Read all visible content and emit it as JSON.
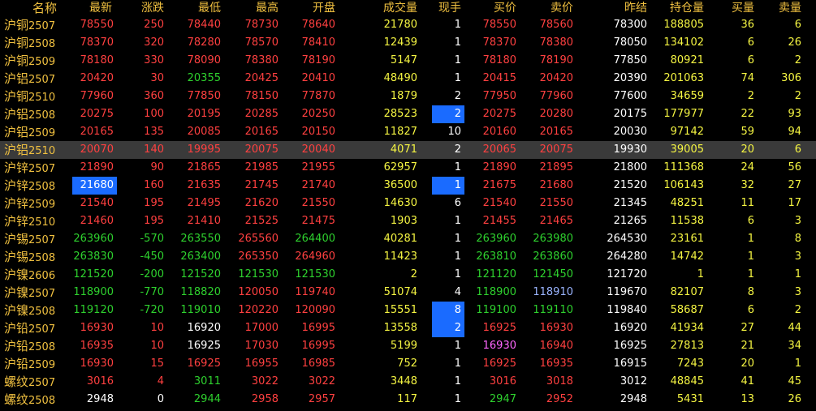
{
  "headers": [
    "名称",
    "最新",
    "涨跌",
    "最低",
    "最高",
    "开盘",
    "成交量",
    "现手",
    "买价",
    "卖价",
    "昨结",
    "持仓量",
    "买量",
    "卖量"
  ],
  "selected_row": 7,
  "rows": [
    {
      "name": "沪铜",
      "code": "2507",
      "last": "78550",
      "chg": "250",
      "low": "78440",
      "high": "78730",
      "open": "78640",
      "vol": "21780",
      "hand": "1",
      "bid": "78550",
      "ask": "78560",
      "prev": "78300",
      "oi": "188805",
      "bidv": "36",
      "askv": "6"
    },
    {
      "name": "沪铜",
      "code": "2508",
      "last": "78370",
      "chg": "320",
      "low": "78280",
      "high": "78570",
      "open": "78410",
      "vol": "12439",
      "hand": "1",
      "bid": "78370",
      "ask": "78380",
      "prev": "78050",
      "oi": "134102",
      "bidv": "6",
      "askv": "26"
    },
    {
      "name": "沪铜",
      "code": "2509",
      "last": "78180",
      "chg": "330",
      "low": "78090",
      "high": "78380",
      "open": "78190",
      "vol": "5147",
      "hand": "1",
      "bid": "78180",
      "ask": "78190",
      "prev": "77850",
      "oi": "80921",
      "bidv": "6",
      "askv": "2"
    },
    {
      "name": "沪铝",
      "code": "2507",
      "last": "20420",
      "chg": "30",
      "low": "20355",
      "high": "20425",
      "open": "20410",
      "vol": "48490",
      "hand": "1",
      "bid": "20415",
      "ask": "20420",
      "prev": "20390",
      "oi": "201063",
      "bidv": "74",
      "askv": "306"
    },
    {
      "name": "沪铜",
      "code": "2510",
      "last": "77960",
      "chg": "360",
      "low": "77850",
      "high": "78150",
      "open": "77870",
      "vol": "1879",
      "hand": "2",
      "bid": "77950",
      "ask": "77960",
      "prev": "77600",
      "oi": "34659",
      "bidv": "2",
      "askv": "2"
    },
    {
      "name": "沪铝",
      "code": "2508",
      "last": "20275",
      "chg": "100",
      "low": "20195",
      "high": "20285",
      "open": "20250",
      "vol": "28523",
      "hand": "2",
      "bid": "20275",
      "ask": "20280",
      "prev": "20175",
      "oi": "177977",
      "bidv": "22",
      "askv": "93"
    },
    {
      "name": "沪铝",
      "code": "2509",
      "last": "20165",
      "chg": "135",
      "low": "20085",
      "high": "20165",
      "open": "20150",
      "vol": "11827",
      "hand": "10",
      "bid": "20160",
      "ask": "20165",
      "prev": "20030",
      "oi": "97142",
      "bidv": "59",
      "askv": "94"
    },
    {
      "name": "沪铝",
      "code": "2510",
      "last": "20070",
      "chg": "140",
      "low": "19995",
      "high": "20075",
      "open": "20040",
      "vol": "4071",
      "hand": "2",
      "bid": "20065",
      "ask": "20075",
      "prev": "19930",
      "oi": "39005",
      "bidv": "20",
      "askv": "6"
    },
    {
      "name": "沪锌",
      "code": "2507",
      "last": "21890",
      "chg": "90",
      "low": "21865",
      "high": "21985",
      "open": "21955",
      "vol": "62957",
      "hand": "1",
      "bid": "21890",
      "ask": "21895",
      "prev": "21800",
      "oi": "111368",
      "bidv": "24",
      "askv": "56"
    },
    {
      "name": "沪锌",
      "code": "2508",
      "last": "21680",
      "chg": "160",
      "low": "21635",
      "high": "21745",
      "open": "21740",
      "vol": "36500",
      "hand": "1",
      "bid": "21675",
      "ask": "21680",
      "prev": "21520",
      "oi": "106143",
      "bidv": "32",
      "askv": "27"
    },
    {
      "name": "沪锌",
      "code": "2509",
      "last": "21540",
      "chg": "195",
      "low": "21495",
      "high": "21620",
      "open": "21550",
      "vol": "14630",
      "hand": "6",
      "bid": "21540",
      "ask": "21550",
      "prev": "21345",
      "oi": "48251",
      "bidv": "11",
      "askv": "17"
    },
    {
      "name": "沪锌",
      "code": "2510",
      "last": "21460",
      "chg": "195",
      "low": "21410",
      "high": "21525",
      "open": "21475",
      "vol": "1903",
      "hand": "1",
      "bid": "21455",
      "ask": "21465",
      "prev": "21265",
      "oi": "11538",
      "bidv": "6",
      "askv": "3"
    },
    {
      "name": "沪锡",
      "code": "2507",
      "last": "263960",
      "chg": "-570",
      "low": "263550",
      "high": "265560",
      "open": "264400",
      "vol": "40281",
      "hand": "1",
      "bid": "263960",
      "ask": "263980",
      "prev": "264530",
      "oi": "23161",
      "bidv": "1",
      "askv": "8"
    },
    {
      "name": "沪锡",
      "code": "2508",
      "last": "263830",
      "chg": "-450",
      "low": "263400",
      "high": "265350",
      "open": "264960",
      "vol": "11423",
      "hand": "1",
      "bid": "263810",
      "ask": "263860",
      "prev": "264280",
      "oi": "14742",
      "bidv": "1",
      "askv": "3"
    },
    {
      "name": "沪镍",
      "code": "2606",
      "last": "121520",
      "chg": "-200",
      "low": "121520",
      "high": "121530",
      "open": "121530",
      "vol": "2",
      "hand": "1",
      "bid": "121120",
      "ask": "121450",
      "prev": "121720",
      "oi": "1",
      "bidv": "1",
      "askv": "1"
    },
    {
      "name": "沪镍",
      "code": "2507",
      "last": "118900",
      "chg": "-770",
      "low": "118820",
      "high": "120050",
      "open": "119740",
      "vol": "51074",
      "hand": "4",
      "bid": "118900",
      "ask": "118910",
      "prev": "119670",
      "oi": "82107",
      "bidv": "8",
      "askv": "3"
    },
    {
      "name": "沪镍",
      "code": "2508",
      "last": "119120",
      "chg": "-720",
      "low": "119010",
      "high": "120220",
      "open": "120090",
      "vol": "15551",
      "hand": "8",
      "bid": "119100",
      "ask": "119110",
      "prev": "119840",
      "oi": "58687",
      "bidv": "6",
      "askv": "2"
    },
    {
      "name": "沪铅",
      "code": "2507",
      "last": "16930",
      "chg": "10",
      "low": "16920",
      "high": "17000",
      "open": "16995",
      "vol": "13558",
      "hand": "2",
      "bid": "16925",
      "ask": "16930",
      "prev": "16920",
      "oi": "41934",
      "bidv": "27",
      "askv": "44"
    },
    {
      "name": "沪铅",
      "code": "2508",
      "last": "16935",
      "chg": "10",
      "low": "16925",
      "high": "17030",
      "open": "16995",
      "vol": "5199",
      "hand": "1",
      "bid": "16930",
      "ask": "16940",
      "prev": "16925",
      "oi": "27813",
      "bidv": "21",
      "askv": "34"
    },
    {
      "name": "沪铅",
      "code": "2509",
      "last": "16930",
      "chg": "15",
      "low": "16925",
      "high": "16955",
      "open": "16985",
      "vol": "752",
      "hand": "1",
      "bid": "16925",
      "ask": "16935",
      "prev": "16915",
      "oi": "7243",
      "bidv": "20",
      "askv": "1"
    },
    {
      "name": "螺纹",
      "code": "2507",
      "last": "3016",
      "chg": "4",
      "low": "3011",
      "high": "3022",
      "open": "3022",
      "vol": "3448",
      "hand": "1",
      "bid": "3016",
      "ask": "3018",
      "prev": "3012",
      "oi": "48845",
      "bidv": "41",
      "askv": "45"
    },
    {
      "name": "螺纹",
      "code": "2508",
      "last": "2948",
      "chg": "0",
      "low": "2944",
      "high": "2958",
      "open": "2957",
      "vol": "117",
      "hand": "1",
      "bid": "2947",
      "ask": "2952",
      "prev": "2948",
      "oi": "5431",
      "bidv": "13",
      "askv": "26"
    }
  ]
}
